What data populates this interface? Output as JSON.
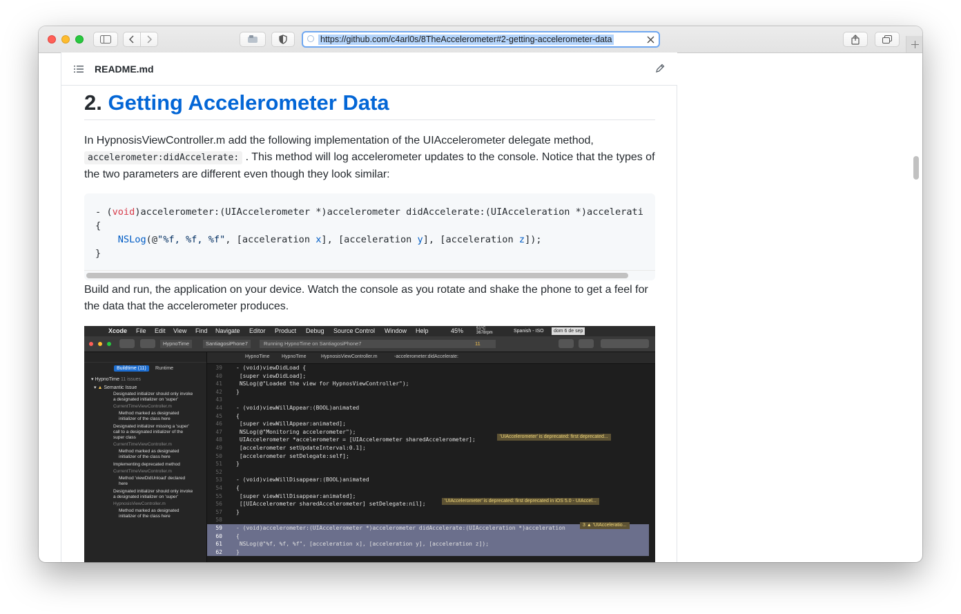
{
  "browser": {
    "url": "https://github.com/c4arl0s/8TheAccelerometer#2-getting-accelerometer-data",
    "colors": {
      "close": "#ff5f57",
      "minimize": "#febc2e",
      "zoom": "#28c840",
      "url_border": "#6ea7f1"
    }
  },
  "readme": {
    "filename": "README.md",
    "heading_number": "2.",
    "heading_link": "Getting Accelerometer Data",
    "para1_a": "In HypnosisViewController.m add the following implementation of the UIAccelerometer delegate method,",
    "para1_code": "accelerometer:didAccelerate:",
    "para1_b": ". This method will log accelerometer updates to the console. Notice that the types of the two parameters are different even though they look similar:",
    "para2": "Build and run, the application on your device. Watch the console as you rotate and shake the phone to get a feel for the data that the accelerometer produces.",
    "link_color": "#0366d6"
  },
  "code": {
    "line1_a": "- (",
    "line1_kw": "void",
    "line1_b": ")accelerometer:(UIAccelerometer *)accelerometer didAccelerate:(UIAcceleration *)accelerati",
    "line2": "{",
    "line3_indent": "    ",
    "line3_fn": "NSLog",
    "line3_a": "(@",
    "line3_str": "\"%f, %f, %f\"",
    "line3_b": ", [acceleration ",
    "line3_x": "x",
    "line3_c": "], [acceleration ",
    "line3_y": "y",
    "line3_d": "], [acceleration ",
    "line3_z": "z",
    "line3_e": "]);",
    "line4": "}"
  },
  "xcode": {
    "menubar": {
      "apple": "",
      "items": [
        "Xcode",
        "File",
        "Edit",
        "View",
        "Find",
        "Navigate",
        "Editor",
        "Product",
        "Debug",
        "Source Control",
        "Window",
        "Help"
      ],
      "battery": "45%",
      "temp": "51°C",
      "rpm": "3678rpm",
      "lang": "Spanish - ISO",
      "date": "dom 6 de sep"
    },
    "toolbar": {
      "scheme": "HypnoTime",
      "device": "SantiagosiPhone7",
      "status": "Running HypnoTime on SantiagosiPhone7",
      "warnings": "11"
    },
    "navigator": {
      "tab_buildtime": "Buildtime (11)",
      "tab_runtime": "Runtime",
      "project": "HypnoTime",
      "project_count": "11 issues",
      "group": "Semantic Issue",
      "issues": [
        "Designated initializer should only invoke a designated initializer on 'super'",
        "CurrentTimeViewController.m",
        "Method marked as designated initializer of the class here",
        "Designated initializer missing a 'super' call to a designated initializer of the super class",
        "CurrentTimeViewController.m",
        "Method marked as designated initializer of the class here",
        "Implementing deprecated method",
        "CurrentTimeViewController.m",
        "Method 'viewDidUnload' declared here",
        "Designated initializer should only invoke a designated initializer on 'super'",
        "HypnosisViewController.m",
        "Method marked as designated initializer of the class here"
      ]
    },
    "jumpbar": {
      "p1": "HypnoTime",
      "p2": "HypnoTime",
      "p3": "HypnosisViewController.m",
      "p4": "-accelerometer:didAccelerate:"
    },
    "code": [
      {
        "n": "39",
        "t": "- (void)viewDidLoad {"
      },
      {
        "n": "40",
        "t": "    [super viewDidLoad];"
      },
      {
        "n": "41",
        "t": "    NSLog(@\"Loaded the view for HypnosViewController\");"
      },
      {
        "n": "42",
        "t": "}"
      },
      {
        "n": "43",
        "t": ""
      },
      {
        "n": "44",
        "t": "- (void)viewWillAppear:(BOOL)animated"
      },
      {
        "n": "45",
        "t": "{"
      },
      {
        "n": "46",
        "t": "    [super viewWillAppear:animated];"
      },
      {
        "n": "47",
        "t": "    NSLog(@\"Monitoring accelerometer\");"
      },
      {
        "n": "48",
        "t": "    UIAccelerometer *accelerometer = [UIAccelerometer sharedAccelerometer];"
      },
      {
        "n": "49",
        "t": "    [accelerometer setUpdateInterval:0.1];"
      },
      {
        "n": "50",
        "t": "    [accelerometer setDelegate:self];"
      },
      {
        "n": "51",
        "t": "}"
      },
      {
        "n": "52",
        "t": ""
      },
      {
        "n": "53",
        "t": "- (void)viewWillDisappear:(BOOL)animated"
      },
      {
        "n": "54",
        "t": "{"
      },
      {
        "n": "55",
        "t": "    [super viewWillDisappear:animated];"
      },
      {
        "n": "56",
        "t": "    [[UIAccelerometer sharedAccelerometer] setDelegate:nil];"
      },
      {
        "n": "57",
        "t": "}"
      },
      {
        "n": "58",
        "t": ""
      },
      {
        "n": "59",
        "t": "- (void)accelerometer:(UIAccelerometer *)accelerometer didAccelerate:(UIAcceleration *)acceleration"
      },
      {
        "n": "60",
        "t": "{"
      },
      {
        "n": "61",
        "t": "    NSLog(@\"%f, %f, %f\", [acceleration x], [acceleration y], [acceleration z]);"
      },
      {
        "n": "62",
        "t": "}"
      }
    ],
    "warning1": "'UIAccelerometer' is deprecated: first deprecated...",
    "warning2": "'UIAccelerometer' is deprecated: first deprecated in iOS 5.0 - UIAccel...",
    "warning3_count": "3",
    "warning3": "'UIAcceleratio..."
  }
}
